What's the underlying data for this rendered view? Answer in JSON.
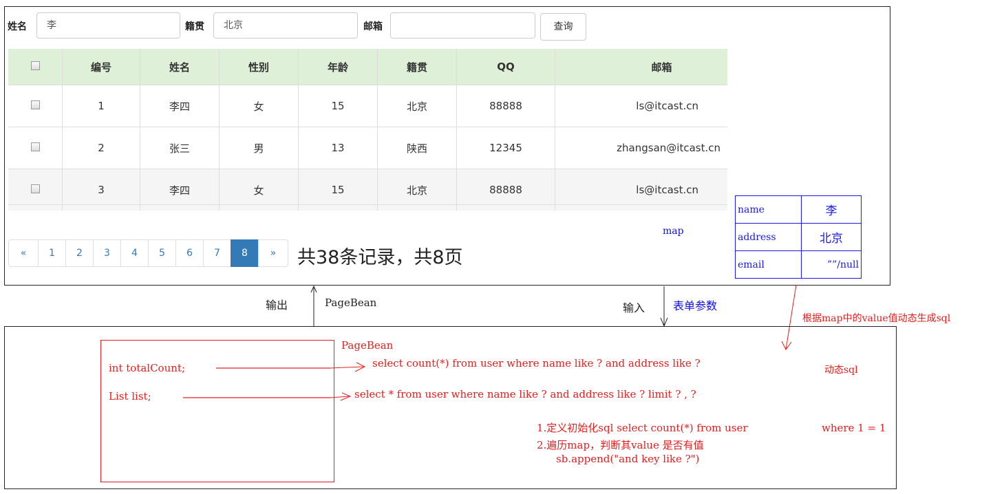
{
  "search": {
    "name_label": "姓名",
    "name_value": "李",
    "native_label": "籍贯",
    "native_value": "北京",
    "email_label": "邮箱",
    "email_value": "",
    "query_button": "查询"
  },
  "table": {
    "headers": [
      "编号",
      "姓名",
      "性别",
      "年龄",
      "籍贯",
      "QQ",
      "邮箱"
    ],
    "rows": [
      [
        "1",
        "李四",
        "女",
        "15",
        "北京",
        "88888",
        "ls@itcast.cn"
      ],
      [
        "2",
        "张三",
        "男",
        "13",
        "陕西",
        "12345",
        "zhangsan@itcast.cn"
      ],
      [
        "3",
        "李四",
        "女",
        "15",
        "北京",
        "88888",
        "ls@itcast.cn"
      ]
    ]
  },
  "pagination": {
    "prev": "«",
    "next": "»",
    "pages": [
      "1",
      "2",
      "3",
      "4",
      "5",
      "6",
      "7",
      "8"
    ],
    "active": "8",
    "summary": "共38条记录，共8页"
  },
  "annotations": {
    "map_label": "map",
    "map_rows": [
      [
        "name",
        "李"
      ],
      [
        "address",
        "北京"
      ],
      [
        "email",
        "””/null"
      ]
    ],
    "output": "输出",
    "pagebean_arrow": "PageBean",
    "input": "输入",
    "form_params": "表单参数",
    "dynamic_note": "根据map中的value值动态生成sql",
    "pagebean_title": "PageBean",
    "field_total": "int totalCount;",
    "field_list": "List list;",
    "sql_count": "select count(*) from user where name like ? and address like ?",
    "sql_list": "select * from user where name like ? and address like ? limit ? , ?",
    "dynamic_sql": "动态sql",
    "step1": "1.定义初始化sql select count(*) from user",
    "step1b": "where 1 = 1",
    "step2": "2.遍历map，判断其value 是否有值",
    "step3": "sb.append(\"and  key like ?\")"
  }
}
